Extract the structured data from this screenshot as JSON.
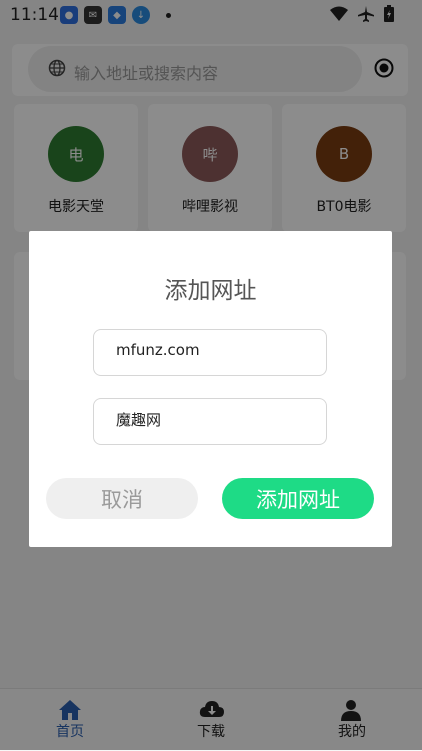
{
  "status_bar": {
    "time": "11:14"
  },
  "search": {
    "placeholder": "输入地址或搜索内容"
  },
  "sites": [
    {
      "initial": "电",
      "name": "电影天堂",
      "color": "#2e7d32"
    },
    {
      "initial": "哔",
      "name": "哔哩影视",
      "color": "#8d5a5a"
    },
    {
      "initial": "B",
      "name": "BT0电影",
      "color": "#7a3d12"
    }
  ],
  "dialog": {
    "title": "添加网址",
    "url_value": "mfunz.com",
    "name_value": "魔趣网",
    "cancel_label": "取消",
    "confirm_label": "添加网址"
  },
  "bottom_nav": [
    {
      "label": "首页",
      "icon": "home-icon",
      "active": true
    },
    {
      "label": "下载",
      "icon": "cloud-download-icon",
      "active": false
    },
    {
      "label": "我的",
      "icon": "user-icon",
      "active": false
    }
  ],
  "colors": {
    "accent": "#1edb86",
    "nav_active": "#2a5fb0"
  }
}
